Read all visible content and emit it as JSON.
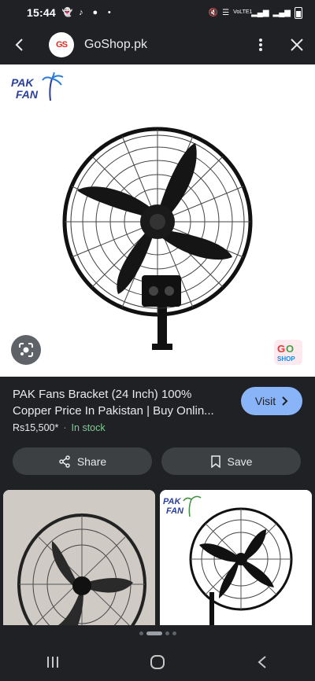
{
  "status": {
    "time": "15:44",
    "network_label": "VoLTE1"
  },
  "header": {
    "site_name": "GoShop.pk",
    "logo_text": "GS"
  },
  "hero": {
    "brand_logo_text": "PAK FAN",
    "badge_text": "GO SHOP"
  },
  "product": {
    "title": "PAK Fans Bracket (24 Inch) 100% Copper Price In Pakistan | Buy Onlin...",
    "price": "Rs15,500*",
    "separator": "·",
    "stock": "In stock",
    "visit_label": "Visit"
  },
  "actions": {
    "share_label": "Share",
    "save_label": "Save"
  },
  "related": {
    "thumb2_logo_text": "PAK FAN"
  },
  "colors": {
    "background": "#202124",
    "accent": "#8ab4f8",
    "stock": "#81c995",
    "button": "#3c4043"
  }
}
